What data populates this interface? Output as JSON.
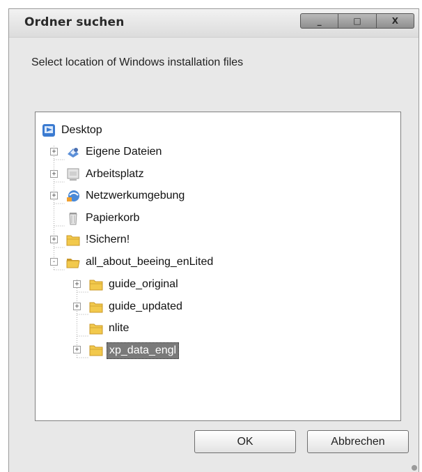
{
  "window": {
    "title": "Ordner suchen",
    "buttons": [
      "_",
      "□",
      "X"
    ]
  },
  "prompt": "Select location of Windows installation files",
  "tree": [
    {
      "label": "Desktop",
      "icon": "desktop-icon",
      "level": 0,
      "expander": null
    },
    {
      "label": "Eigene Dateien",
      "icon": "my-documents-icon",
      "level": 1,
      "expander": "+"
    },
    {
      "label": "Arbeitsplatz",
      "icon": "computer-icon",
      "level": 1,
      "expander": "+"
    },
    {
      "label": "Netzwerkumgebung",
      "icon": "network-icon",
      "level": 1,
      "expander": "+"
    },
    {
      "label": "Papierkorb",
      "icon": "recycle-bin-icon",
      "level": 1,
      "expander": null
    },
    {
      "label": "!Sichern!",
      "icon": "folder-icon",
      "level": 1,
      "expander": "+"
    },
    {
      "label": "all_about_beeing_enLited",
      "icon": "open-folder-icon",
      "level": 1,
      "expander": "-"
    },
    {
      "label": "guide_original",
      "icon": "folder-icon",
      "level": 2,
      "expander": "+"
    },
    {
      "label": "guide_updated",
      "icon": "folder-icon",
      "level": 2,
      "expander": "+"
    },
    {
      "label": "nlite",
      "icon": "folder-icon",
      "level": 2,
      "expander": null
    },
    {
      "label": "xp_data_engl",
      "icon": "folder-icon",
      "level": 2,
      "expander": "+",
      "selected": true
    }
  ],
  "buttons": {
    "ok": "OK",
    "cancel": "Abbrechen"
  },
  "colors": {
    "selection": "#7a7a7a",
    "folder": "#f2c94c",
    "folder_dark": "#c9982a"
  }
}
